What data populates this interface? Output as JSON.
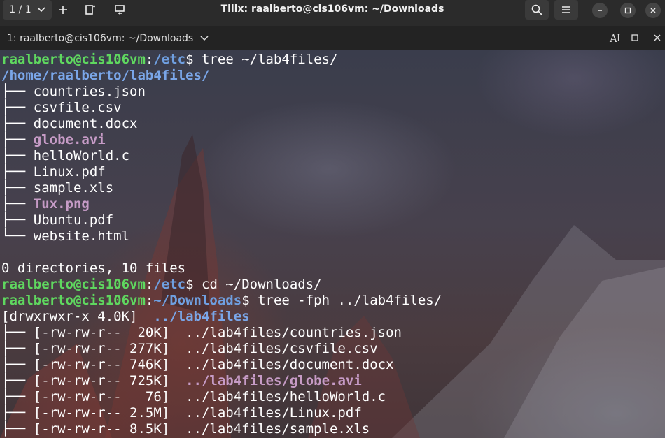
{
  "window": {
    "tab_counter": "1 / 1",
    "title": "Tilix: raalberto@cis106vm: ~/Downloads"
  },
  "tabbar": {
    "session_label": "1: raalberto@cis106vm: ~/Downloads",
    "ai_label": "A"
  },
  "colors": {
    "prompt_user": "#5fd75f",
    "prompt_path": "#6f9fe0",
    "media_file": "#c69bc6",
    "directory": "#7aa6e8"
  },
  "terminal": {
    "lines": [
      [
        {
          "t": "raalberto@cis106vm",
          "c": "green"
        },
        {
          "t": ":",
          "c": "white"
        },
        {
          "t": "/etc",
          "c": "blue"
        },
        {
          "t": "$ tree ~/lab4files/",
          "c": "white"
        }
      ],
      [
        {
          "t": "/home/raalberto/lab4files/",
          "c": "dir"
        }
      ],
      [
        {
          "t": "├── ",
          "c": "white"
        },
        {
          "t": "countries.json",
          "c": "white"
        }
      ],
      [
        {
          "t": "├── ",
          "c": "white"
        },
        {
          "t": "csvfile.csv",
          "c": "white"
        }
      ],
      [
        {
          "t": "├── ",
          "c": "white"
        },
        {
          "t": "document.docx",
          "c": "white"
        }
      ],
      [
        {
          "t": "├── ",
          "c": "white"
        },
        {
          "t": "globe.avi",
          "c": "magenta"
        }
      ],
      [
        {
          "t": "├── ",
          "c": "white"
        },
        {
          "t": "helloWorld.c",
          "c": "white"
        }
      ],
      [
        {
          "t": "├── ",
          "c": "white"
        },
        {
          "t": "Linux.pdf",
          "c": "white"
        }
      ],
      [
        {
          "t": "├── ",
          "c": "white"
        },
        {
          "t": "sample.xls",
          "c": "white"
        }
      ],
      [
        {
          "t": "├── ",
          "c": "white"
        },
        {
          "t": "Tux.png",
          "c": "magenta"
        }
      ],
      [
        {
          "t": "├── ",
          "c": "white"
        },
        {
          "t": "Ubuntu.pdf",
          "c": "white"
        }
      ],
      [
        {
          "t": "└── ",
          "c": "white"
        },
        {
          "t": "website.html",
          "c": "white"
        }
      ],
      [
        {
          "t": "",
          "c": "white"
        }
      ],
      [
        {
          "t": "0 directories, 10 files",
          "c": "white"
        }
      ],
      [
        {
          "t": "raalberto@cis106vm",
          "c": "green"
        },
        {
          "t": ":",
          "c": "white"
        },
        {
          "t": "/etc",
          "c": "blue"
        },
        {
          "t": "$ cd ~/Downloads/",
          "c": "white"
        }
      ],
      [
        {
          "t": "raalberto@cis106vm",
          "c": "green"
        },
        {
          "t": ":",
          "c": "white"
        },
        {
          "t": "~/Downloads",
          "c": "blue"
        },
        {
          "t": "$ tree -fph ../lab4files/",
          "c": "white"
        }
      ],
      [
        {
          "t": "[drwxrwxr-x 4.0K]  ",
          "c": "white"
        },
        {
          "t": "../lab4files",
          "c": "dir"
        }
      ],
      [
        {
          "t": "├── [-rw-rw-r--  20K]  ../lab4files/countries.json",
          "c": "white"
        }
      ],
      [
        {
          "t": "├── [-rw-rw-r-- 277K]  ../lab4files/csvfile.csv",
          "c": "white"
        }
      ],
      [
        {
          "t": "├── [-rw-rw-r-- 746K]  ../lab4files/document.docx",
          "c": "white"
        }
      ],
      [
        {
          "t": "├── [-rw-rw-r-- 725K]  ",
          "c": "white"
        },
        {
          "t": "../lab4files/globe.avi",
          "c": "magenta"
        }
      ],
      [
        {
          "t": "├── [-rw-rw-r--   76]  ../lab4files/helloWorld.c",
          "c": "white"
        }
      ],
      [
        {
          "t": "├── [-rw-rw-r-- 2.5M]  ../lab4files/Linux.pdf",
          "c": "white"
        }
      ],
      [
        {
          "t": "├── [-rw-rw-r-- 8.5K]  ../lab4files/sample.xls",
          "c": "white"
        }
      ]
    ]
  }
}
